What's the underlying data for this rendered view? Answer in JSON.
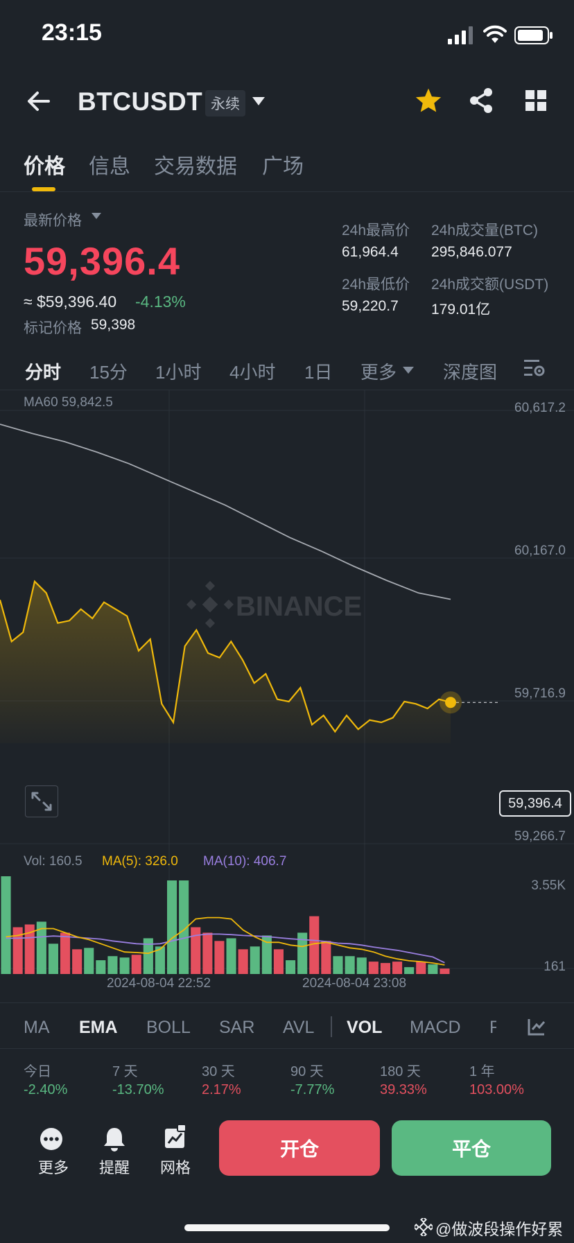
{
  "status": {
    "time": "23:15"
  },
  "header": {
    "symbol": "BTCUSDT",
    "contract_type": "永续"
  },
  "tabs": [
    {
      "label": "价格"
    },
    {
      "label": "信息"
    },
    {
      "label": "交易数据"
    },
    {
      "label": "广场"
    }
  ],
  "ticker": {
    "last_price_label": "最新价格",
    "last_price": "59,396.4",
    "approx_usd": "≈ $59,396.40",
    "change_pct": "-4.13%",
    "mark_price_label": "标记价格",
    "mark_price": "59,398",
    "high_label": "24h最高价",
    "high_value": "61,964.4",
    "low_label": "24h最低价",
    "low_value": "59,220.7",
    "vol_btc_label": "24h成交量(BTC)",
    "vol_btc_value": "295,846.077",
    "vol_usdt_label": "24h成交额(USDT)",
    "vol_usdt_value": "179.01亿"
  },
  "intervals": [
    {
      "label": "分时"
    },
    {
      "label": "15分"
    },
    {
      "label": "1小时"
    },
    {
      "label": "4小时"
    },
    {
      "label": "1日"
    },
    {
      "label": "更多"
    },
    {
      "label": "深度图"
    }
  ],
  "colors": {
    "up": "#5ab982",
    "down": "#e4505f",
    "accent": "#f0b90b",
    "ma60": "#a7abb2",
    "ma5": "#f0b90b",
    "ma10": "#9a7fe0"
  },
  "chart_labels": {
    "ma60": "MA60 59,842.5",
    "watermark": "BINANCE",
    "current_price": "59,396.4",
    "y_ticks": [
      "60,617.2",
      "60,167.0",
      "59,716.9",
      "59,266.7"
    ],
    "vol_label": "Vol: 160.5",
    "ma5_label": "MA(5): 326.0",
    "ma10_label": "MA(10): 406.7",
    "vol_ticks": [
      "3.55K",
      "161"
    ],
    "x_ticks": [
      "2024-08-04 22:52",
      "2024-08-04 23:08"
    ]
  },
  "chart_data": [
    {
      "type": "line",
      "series": [
        {
          "name": "MA60",
          "values": [
            60600,
            60560,
            60525,
            60480,
            60430,
            60370,
            60310,
            60250,
            60180,
            60110,
            60050,
            59985,
            59925,
            59870,
            59842.5
          ]
        }
      ],
      "ylim": [
        59220,
        60660
      ]
    },
    {
      "type": "area",
      "values": [
        59840,
        59660,
        59700,
        59920,
        59870,
        59740,
        59750,
        59800,
        59760,
        59830,
        59800,
        59770,
        59620,
        59670,
        59390,
        59310,
        59640,
        59710,
        59610,
        59590,
        59660,
        59580,
        59480,
        59520,
        59410,
        59400,
        59460,
        59300,
        59340,
        59270,
        59340,
        59280,
        59320,
        59310,
        59330,
        59400,
        59390,
        59370,
        59410,
        59396.4
      ],
      "ylim": [
        59220,
        60660
      ]
    },
    {
      "type": "bar",
      "values": [
        3550,
        1700,
        1800,
        1900,
        1100,
        1500,
        900,
        950,
        500,
        650,
        600,
        700,
        1300,
        1000,
        3400,
        3400,
        1700,
        1500,
        1200,
        1300,
        900,
        1000,
        1400,
        900,
        500,
        1500,
        2100,
        1200,
        650,
        650,
        600,
        450,
        400,
        450,
        250,
        450,
        350,
        200
      ],
      "up": [
        true,
        false,
        false,
        true,
        true,
        false,
        false,
        true,
        true,
        true,
        true,
        false,
        true,
        true,
        true,
        true,
        false,
        false,
        false,
        true,
        false,
        true,
        true,
        false,
        true,
        true,
        false,
        false,
        true,
        true,
        true,
        false,
        false,
        false,
        true,
        false,
        true,
        false
      ],
      "ma5": [
        1350,
        1400,
        1500,
        1650,
        1650,
        1500,
        1350,
        1250,
        1100,
        950,
        800,
        780,
        750,
        900,
        1300,
        1600,
        2000,
        2050,
        2050,
        2000,
        1600,
        1350,
        1150,
        1150,
        1050,
        1000,
        1100,
        1150,
        1050,
        950,
        900,
        800,
        650,
        550,
        480,
        450,
        400,
        330
      ],
      "ma10": [
        1300,
        1300,
        1320,
        1350,
        1380,
        1360,
        1330,
        1300,
        1270,
        1200,
        1150,
        1100,
        1080,
        1100,
        1200,
        1300,
        1400,
        1450,
        1450,
        1430,
        1400,
        1380,
        1360,
        1320,
        1280,
        1250,
        1220,
        1180,
        1120,
        1100,
        1050,
        980,
        920,
        860,
        780,
        700,
        620,
        410
      ]
    }
  ],
  "indicators": [
    {
      "label": "MA"
    },
    {
      "label": "EMA"
    },
    {
      "label": "BOLL"
    },
    {
      "label": "SAR"
    },
    {
      "label": "AVL"
    },
    {
      "label": "VOL"
    },
    {
      "label": "MACD"
    },
    {
      "label": "R"
    }
  ],
  "performance": [
    {
      "period": "今日",
      "value": "-2.40%"
    },
    {
      "period": "7 天",
      "value": "-13.70%"
    },
    {
      "period": "30 天",
      "value": "2.17%"
    },
    {
      "period": "90 天",
      "value": "-7.77%"
    },
    {
      "period": "180 天",
      "value": "39.33%"
    },
    {
      "period": "1 年",
      "value": "103.00%"
    }
  ],
  "bottom": {
    "more_label": "更多",
    "alert_label": "提醒",
    "grid_label": "网格",
    "open_label": "开仓",
    "close_label": "平仓"
  },
  "watermark_user": "@做波段操作好累"
}
